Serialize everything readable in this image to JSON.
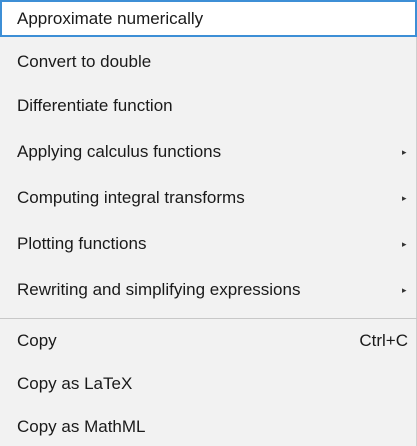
{
  "menu": {
    "items": [
      {
        "label": "Approximate numerically"
      },
      {
        "label": "Convert to double"
      },
      {
        "label": "Differentiate function"
      },
      {
        "label": "Applying calculus functions",
        "submenu_icon": "▸"
      },
      {
        "label": "Computing integral transforms",
        "submenu_icon": "▸"
      },
      {
        "label": "Plotting functions",
        "submenu_icon": "▸"
      },
      {
        "label": "Rewriting and simplifying expressions",
        "submenu_icon": "▸"
      },
      {
        "label": "Copy",
        "shortcut": "Ctrl+C"
      },
      {
        "label": "Copy as LaTeX"
      },
      {
        "label": "Copy as MathML"
      }
    ]
  },
  "colors": {
    "menu_background": "#f2f2f2",
    "highlight_border": "#3d8fd6",
    "highlight_background": "#ffffff",
    "separator": "#c8c8c8"
  }
}
